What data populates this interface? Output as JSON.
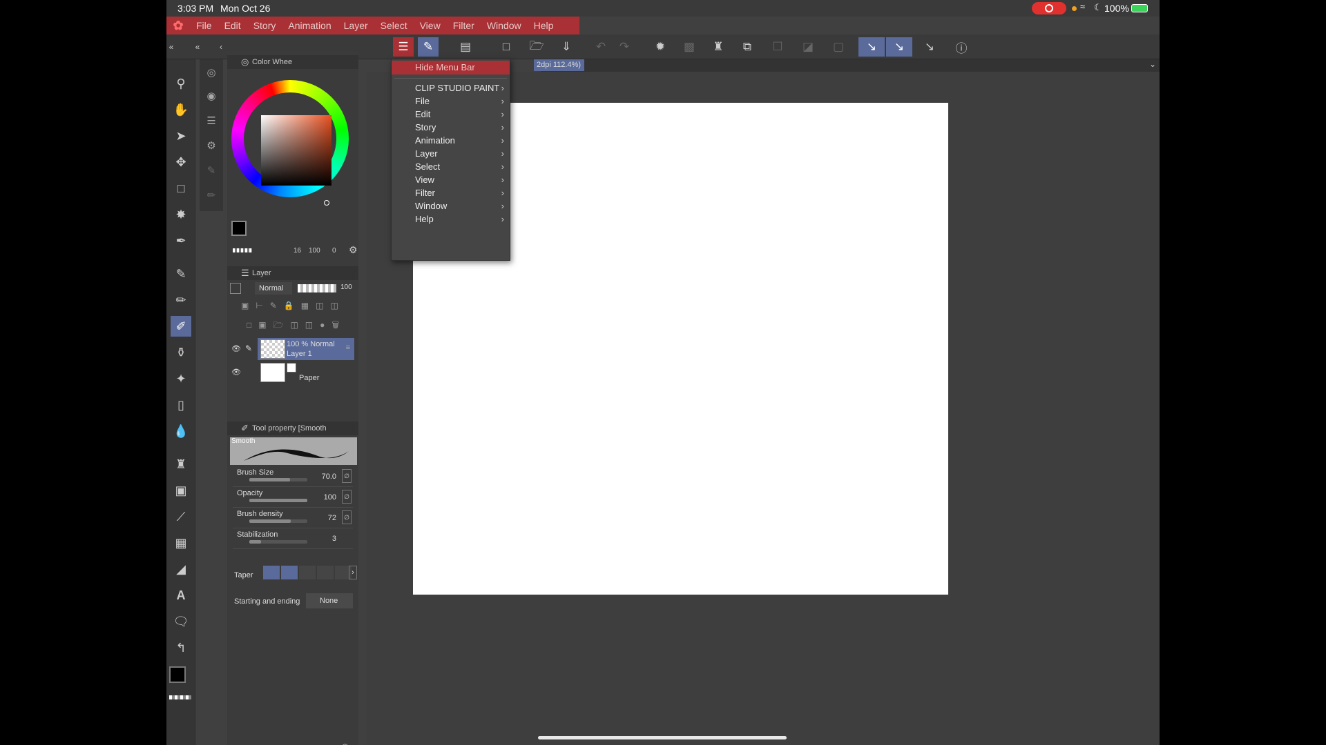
{
  "status": {
    "time": "3:03 PM",
    "date": "Mon Oct 26",
    "battery": "100%"
  },
  "menubar": {
    "items": [
      "File",
      "Edit",
      "Story",
      "Animation",
      "Layer",
      "Select",
      "View",
      "Filter",
      "Window",
      "Help"
    ]
  },
  "canvas_tab": "2dpi 112.4%)",
  "dropdown": {
    "first": "Hide Menu Bar",
    "items": [
      "CLIP STUDIO PAINT",
      "File",
      "Edit",
      "Story",
      "Animation",
      "Layer",
      "Select",
      "View",
      "Filter",
      "Window",
      "Help"
    ]
  },
  "color_panel": {
    "title": "Color Whee",
    "footer_a": "16",
    "footer_b": "100",
    "footer_c": "0"
  },
  "layer_panel": {
    "title": "Layer",
    "blend": "Normal",
    "opacity": "100",
    "layers": [
      {
        "line1": "100 %  Normal",
        "line2": "Layer 1"
      },
      {
        "line1": "",
        "line2": "Paper"
      }
    ]
  },
  "tool_property": {
    "title": "Tool property [Smooth",
    "preset": "Smooth",
    "props": [
      {
        "name": "Brush Size",
        "value": "70.0",
        "fill": 0.7
      },
      {
        "name": "Opacity",
        "value": "100",
        "fill": 1.0
      },
      {
        "name": "Brush density",
        "value": "72",
        "fill": 0.72
      },
      {
        "name": "Stabilization",
        "value": "3",
        "fill": 0.2
      }
    ],
    "taper_label": "Taper",
    "start_end_label": "Starting and ending",
    "start_end_value": "None"
  },
  "colors": {
    "accent": "#a93034",
    "selection": "#5a6a9a",
    "panel": "#3b3b3b"
  }
}
